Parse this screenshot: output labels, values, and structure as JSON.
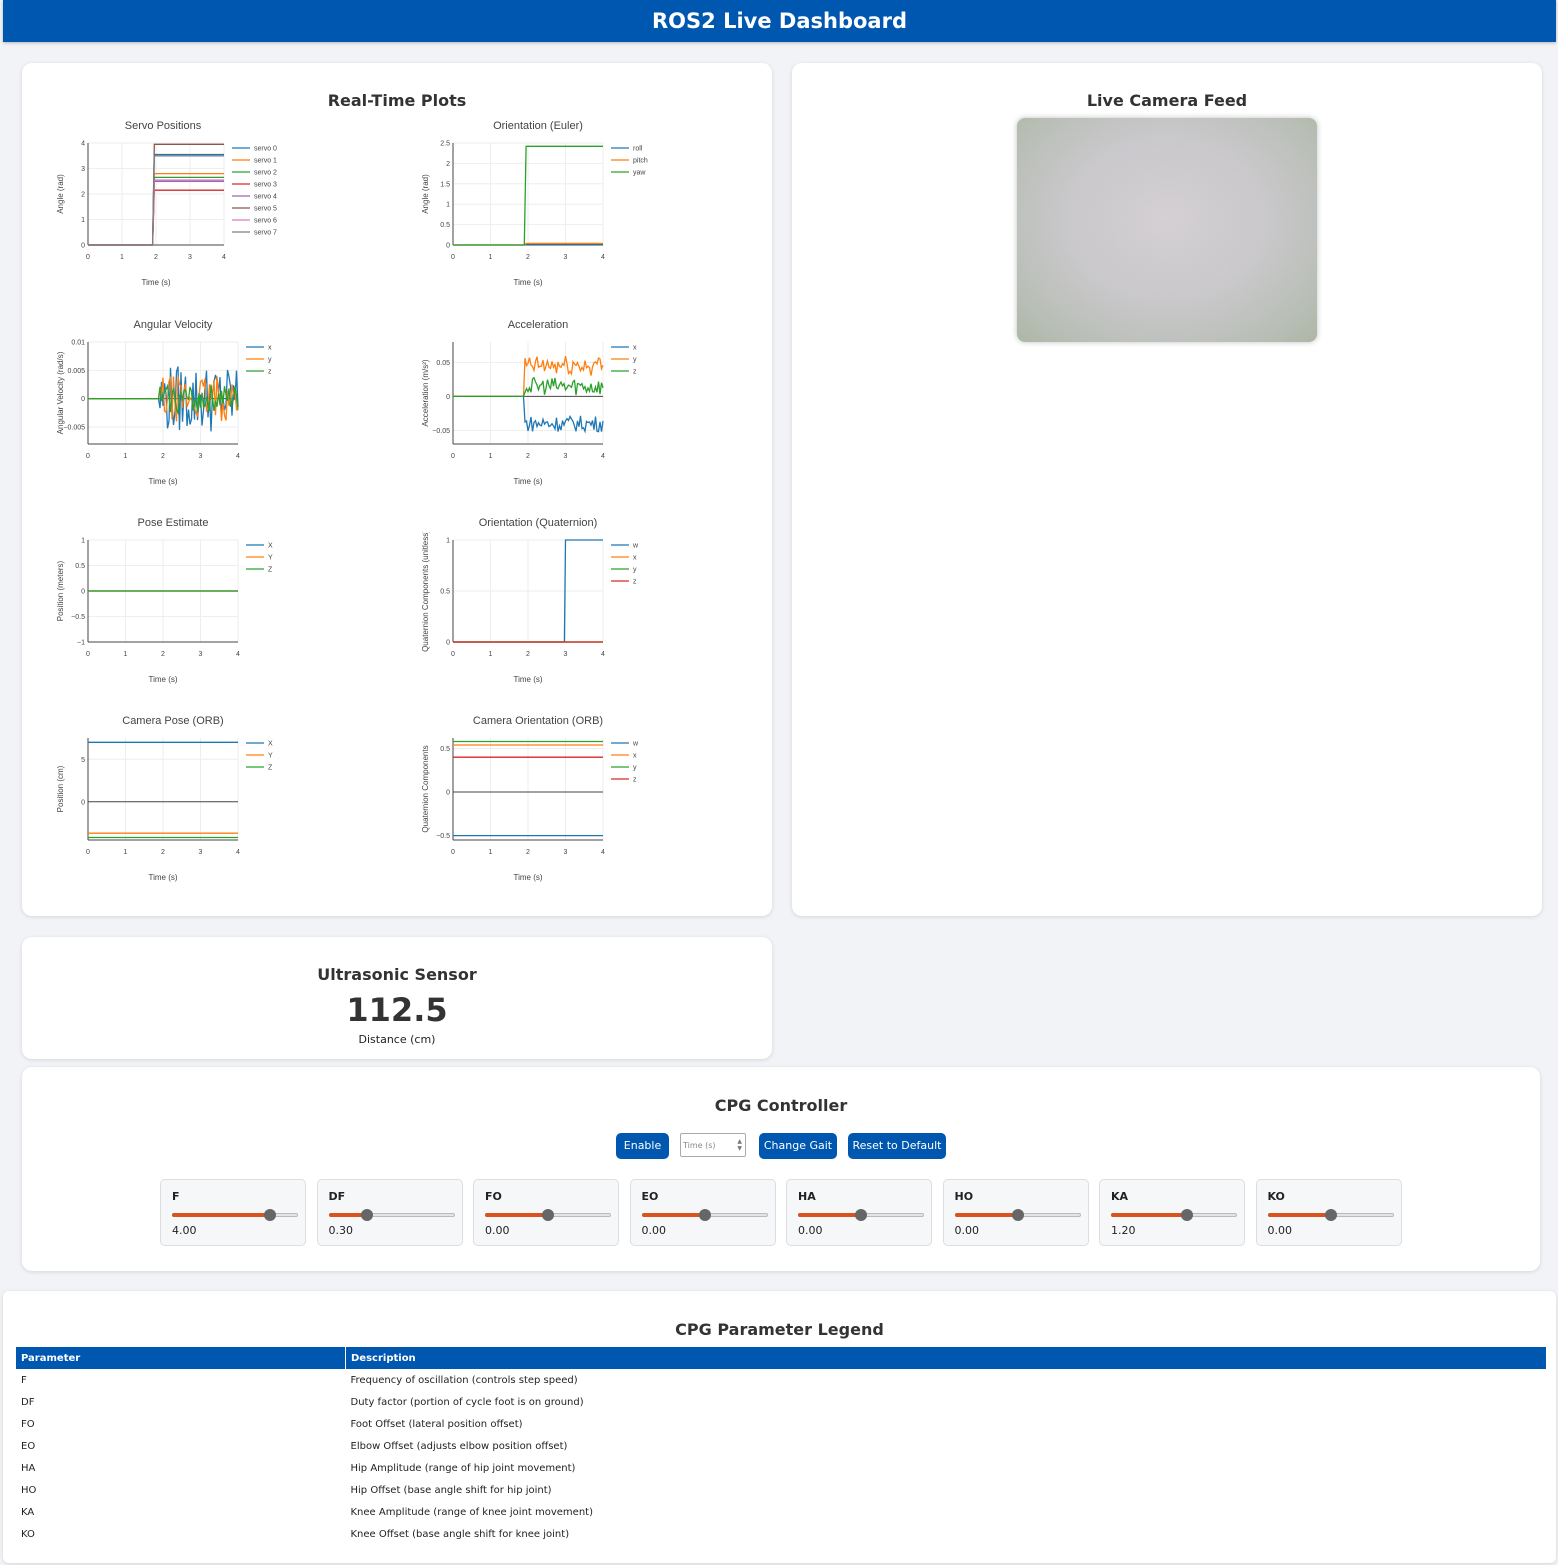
{
  "header": {
    "title": "ROS2 Live Dashboard"
  },
  "plots_panel": {
    "title": "Real-Time Plots"
  },
  "camera_panel": {
    "title": "Live Camera Feed"
  },
  "ultrasonic": {
    "title": "Ultrasonic Sensor",
    "value": "112.5",
    "unit_label": "Distance (cm)"
  },
  "cpg": {
    "title": "CPG Controller",
    "enable_label": "Enable",
    "time_placeholder": "Time (s)",
    "change_gait_label": "Change Gait",
    "reset_label": "Reset to Default",
    "sliders": [
      {
        "name": "F",
        "value": "4.00",
        "fraction": 0.78
      },
      {
        "name": "DF",
        "value": "0.30",
        "fraction": 0.3
      },
      {
        "name": "FO",
        "value": "0.00",
        "fraction": 0.5
      },
      {
        "name": "EO",
        "value": "0.00",
        "fraction": 0.5
      },
      {
        "name": "HA",
        "value": "0.00",
        "fraction": 0.5
      },
      {
        "name": "HO",
        "value": "0.00",
        "fraction": 0.5
      },
      {
        "name": "KA",
        "value": "1.20",
        "fraction": 0.6
      },
      {
        "name": "KO",
        "value": "0.00",
        "fraction": 0.5
      }
    ]
  },
  "legend": {
    "title": "CPG Parameter Legend",
    "headers": [
      "Parameter",
      "Description"
    ],
    "rows": [
      [
        "F",
        "Frequency of oscillation (controls step speed)"
      ],
      [
        "DF",
        "Duty factor (portion of cycle foot is on ground)"
      ],
      [
        "FO",
        "Foot Offset (lateral position offset)"
      ],
      [
        "EO",
        "Elbow Offset (adjusts elbow position offset)"
      ],
      [
        "HA",
        "Hip Amplitude (range of hip joint movement)"
      ],
      [
        "HO",
        "Hip Offset (base angle shift for hip joint)"
      ],
      [
        "KA",
        "Knee Amplitude (range of knee joint movement)"
      ],
      [
        "KO",
        "Knee Offset (base angle shift for knee joint)"
      ]
    ]
  },
  "colors": {
    "header": "#0057b0",
    "slider_fill": "#d9531e",
    "series": [
      "#1f77b4",
      "#ff7f0e",
      "#2ca02c",
      "#d62728",
      "#9467bd",
      "#8c564b",
      "#e377c2",
      "#7f7f7f"
    ]
  },
  "chart_data": [
    {
      "type": "line",
      "title": "Servo Positions",
      "xlabel": "Time (s)",
      "ylabel": "Angle (rad)",
      "xlim": [
        0,
        4
      ],
      "ylim": [
        0,
        4
      ],
      "xticks": [
        "0",
        "1",
        "2",
        "3",
        "4"
      ],
      "yticks": [
        "0",
        "1",
        "2",
        "3",
        "4"
      ],
      "series": [
        {
          "name": "servo 0",
          "x": [
            0,
            1.9,
            1.95,
            4
          ],
          "y": [
            0,
            0,
            3.55,
            3.55
          ]
        },
        {
          "name": "servo 1",
          "x": [
            0,
            1.9,
            1.95,
            4
          ],
          "y": [
            0,
            0,
            2.8,
            2.8
          ]
        },
        {
          "name": "servo 2",
          "x": [
            0,
            1.9,
            1.95,
            4
          ],
          "y": [
            0,
            0,
            2.65,
            2.65
          ]
        },
        {
          "name": "servo 3",
          "x": [
            0,
            1.9,
            1.95,
            4
          ],
          "y": [
            0,
            0,
            2.15,
            2.15
          ]
        },
        {
          "name": "servo 4",
          "x": [
            0,
            1.9,
            1.95,
            4
          ],
          "y": [
            0,
            0,
            2.5,
            2.5
          ]
        },
        {
          "name": "servo 5",
          "x": [
            0,
            1.9,
            1.95,
            4
          ],
          "y": [
            0,
            0,
            3.95,
            3.95
          ]
        },
        {
          "name": "servo 6",
          "x": [
            0,
            1.9,
            1.95,
            4
          ],
          "y": [
            0,
            0,
            2.55,
            2.55
          ]
        },
        {
          "name": "servo 7",
          "x": [
            0,
            1.9,
            1.95,
            4
          ],
          "y": [
            0,
            0,
            3.5,
            3.5
          ]
        }
      ]
    },
    {
      "type": "line",
      "title": "Orientation (Euler)",
      "xlabel": "Time (s)",
      "ylabel": "Angle (rad)",
      "xlim": [
        0,
        4
      ],
      "ylim": [
        0,
        2.5
      ],
      "xticks": [
        "0",
        "1",
        "2",
        "3",
        "4"
      ],
      "yticks": [
        "0",
        "0.5",
        "1",
        "1.5",
        "2",
        "2.5"
      ],
      "series": [
        {
          "name": "roll",
          "x": [
            0,
            1.9,
            1.95,
            4
          ],
          "y": [
            0,
            0,
            0.02,
            0.02
          ]
        },
        {
          "name": "pitch",
          "x": [
            0,
            1.9,
            1.95,
            4
          ],
          "y": [
            0,
            0,
            0.04,
            0.04
          ]
        },
        {
          "name": "yaw",
          "x": [
            0,
            1.9,
            1.95,
            4
          ],
          "y": [
            0,
            0,
            2.42,
            2.42
          ]
        }
      ]
    },
    {
      "type": "line",
      "title": "Angular Velocity",
      "xlabel": "Time (s)",
      "ylabel": "Angular Velocity (rad/s)",
      "xlim": [
        0,
        4
      ],
      "ylim": [
        -0.008,
        0.01
      ],
      "xticks": [
        "0",
        "1",
        "2",
        "3",
        "4"
      ],
      "yticks": [
        "−0.005",
        "0",
        "0.005",
        "0.01"
      ],
      "noise": true,
      "series": [
        {
          "name": "x",
          "amp": 0.006,
          "start": 1.9
        },
        {
          "name": "y",
          "amp": 0.004,
          "start": 1.9
        },
        {
          "name": "z",
          "amp": 0.0025,
          "start": 1.9
        }
      ]
    },
    {
      "type": "line",
      "title": "Acceleration",
      "xlabel": "Time (s)",
      "ylabel": "Acceleration (m/s²)",
      "xlim": [
        0,
        4
      ],
      "ylim": [
        -0.07,
        0.08
      ],
      "xticks": [
        "0",
        "1",
        "2",
        "3",
        "4"
      ],
      "yticks": [
        "−0.05",
        "0",
        "0.05"
      ],
      "noise": true,
      "series": [
        {
          "name": "x",
          "level": -0.04,
          "amp": 0.012,
          "start": 1.9
        },
        {
          "name": "y",
          "level": 0.045,
          "amp": 0.015,
          "start": 1.9
        },
        {
          "name": "z",
          "level": 0.015,
          "amp": 0.013,
          "start": 1.9
        }
      ]
    },
    {
      "type": "line",
      "title": "Pose Estimate",
      "xlabel": "Time (s)",
      "ylabel": "Position (meters)",
      "xlim": [
        0,
        4
      ],
      "ylim": [
        -1,
        1
      ],
      "xticks": [
        "0",
        "1",
        "2",
        "3",
        "4"
      ],
      "yticks": [
        "−1",
        "−0.5",
        "0",
        "0.5",
        "1"
      ],
      "series": [
        {
          "name": "X",
          "x": [
            0,
            4
          ],
          "y": [
            0,
            0
          ]
        },
        {
          "name": "Y",
          "x": [
            0,
            4
          ],
          "y": [
            0,
            0
          ]
        },
        {
          "name": "Z",
          "x": [
            0,
            4
          ],
          "y": [
            0,
            0
          ]
        }
      ]
    },
    {
      "type": "line",
      "title": "Orientation (Quaternion)",
      "xlabel": "Time (s)",
      "ylabel": "Quaternion Components (unitless)",
      "xlim": [
        0,
        4
      ],
      "ylim": [
        0,
        1
      ],
      "xticks": [
        "0",
        "1",
        "2",
        "3",
        "4"
      ],
      "yticks": [
        "0",
        "0.5",
        "1"
      ],
      "series": [
        {
          "name": "w",
          "x": [
            0,
            2.97,
            3.0,
            4
          ],
          "y": [
            0,
            0,
            1,
            1
          ]
        },
        {
          "name": "x",
          "x": [
            0,
            4
          ],
          "y": [
            0,
            0
          ]
        },
        {
          "name": "y",
          "x": [
            0,
            4
          ],
          "y": [
            0,
            0
          ]
        },
        {
          "name": "z",
          "x": [
            0,
            4
          ],
          "y": [
            0,
            0
          ]
        }
      ]
    },
    {
      "type": "line",
      "title": "Camera Pose (ORB)",
      "xlabel": "Time (s)",
      "ylabel": "Position (cm)",
      "xlim": [
        0,
        4
      ],
      "ylim": [
        -4.5,
        7.5
      ],
      "xticks": [
        "0",
        "1",
        "2",
        "3",
        "4"
      ],
      "yticks": [
        "0",
        "5"
      ],
      "series": [
        {
          "name": "X",
          "x": [
            0,
            4
          ],
          "y": [
            7,
            7
          ]
        },
        {
          "name": "Y",
          "x": [
            0,
            4
          ],
          "y": [
            -3.7,
            -3.7
          ]
        },
        {
          "name": "Z",
          "x": [
            0,
            4
          ],
          "y": [
            -4.2,
            -4.2
          ]
        }
      ]
    },
    {
      "type": "line",
      "title": "Camera Orientation (ORB)",
      "xlabel": "Time (s)",
      "ylabel": "Quaternion Components",
      "xlim": [
        0,
        4
      ],
      "ylim": [
        -0.55,
        0.62
      ],
      "xticks": [
        "0",
        "1",
        "2",
        "3",
        "4"
      ],
      "yticks": [
        "−0.5",
        "0",
        "0.5"
      ],
      "series": [
        {
          "name": "w",
          "x": [
            0,
            4
          ],
          "y": [
            -0.5,
            -0.5
          ]
        },
        {
          "name": "x",
          "x": [
            0,
            4
          ],
          "y": [
            0.54,
            0.54
          ]
        },
        {
          "name": "y",
          "x": [
            0,
            4
          ],
          "y": [
            0.58,
            0.58
          ]
        },
        {
          "name": "z",
          "x": [
            0,
            4
          ],
          "y": [
            0.4,
            0.4
          ]
        }
      ]
    }
  ]
}
